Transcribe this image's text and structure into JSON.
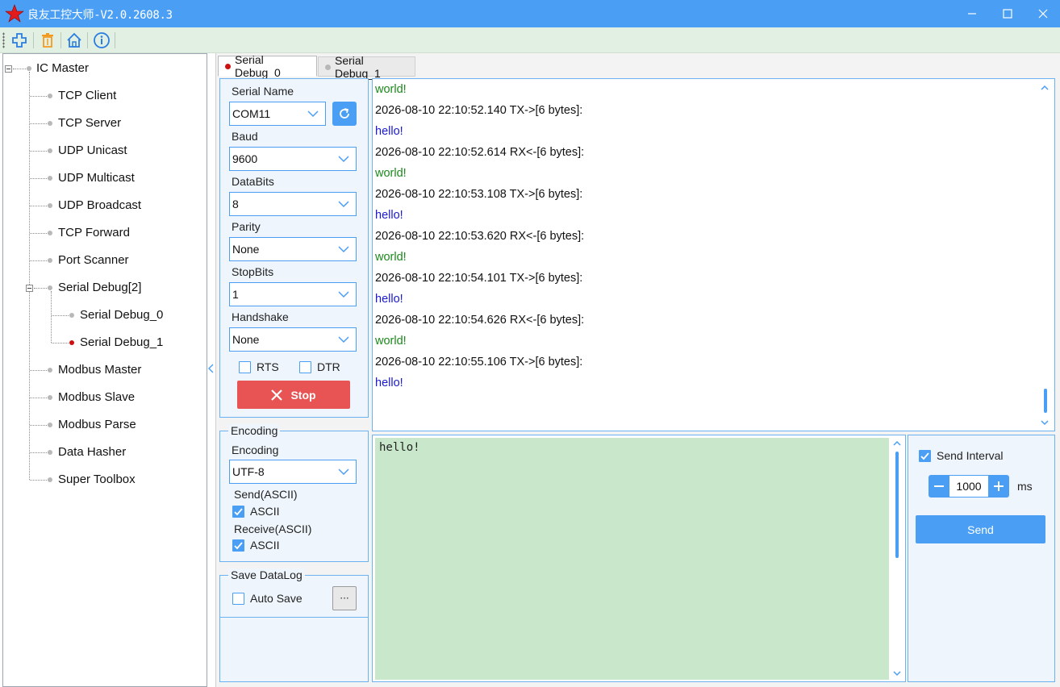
{
  "window": {
    "title": "良友工控大师-V2.0.2608.3",
    "controls": [
      "minimize",
      "maximize",
      "close"
    ]
  },
  "toolbar": {
    "items": [
      {
        "name": "add",
        "icon": "plus-icon"
      },
      {
        "name": "delete",
        "icon": "trash-icon"
      },
      {
        "name": "home",
        "icon": "home-icon"
      },
      {
        "name": "info",
        "icon": "info-icon"
      }
    ]
  },
  "tree": {
    "root": "IC Master",
    "items": [
      "TCP Client",
      "TCP Server",
      "UDP Unicast",
      "UDP Multicast",
      "UDP Broadcast",
      "TCP Forward",
      "Port Scanner",
      "Serial Debug[2]",
      "Serial Debug_0",
      "Serial Debug_1",
      "Modbus Master",
      "Modbus Slave",
      "Modbus Parse",
      "Data Hasher",
      "Super Toolbox"
    ]
  },
  "tabs": [
    {
      "label": "Serial Debug_0",
      "active": true,
      "dot_color": "#cc1111"
    },
    {
      "label": "Serial Debug_1",
      "active": false,
      "dot_color": "#b8b8b8"
    }
  ],
  "serial": {
    "name_label": "Serial Name",
    "name_value": "COM11",
    "baud_label": "Baud",
    "baud_value": "9600",
    "databits_label": "DataBits",
    "databits_value": "8",
    "parity_label": "Parity",
    "parity_value": "None",
    "stopbits_label": "StopBits",
    "stopbits_value": "1",
    "handshake_label": "Handshake",
    "handshake_value": "None",
    "rts_label": "RTS",
    "dtr_label": "DTR",
    "stop_label": "Stop"
  },
  "encoding": {
    "group_title": "Encoding",
    "label": "Encoding",
    "value": "UTF-8",
    "send_label": "Send(ASCII)",
    "send_check": "ASCII",
    "recv_label": "Receive(ASCII)",
    "recv_check": "ASCII"
  },
  "datalog": {
    "group_title": "Save DataLog",
    "auto_save_label": "Auto Save",
    "browse_label": "···"
  },
  "log": [
    {
      "text": "world!",
      "color": "#1a8a1a"
    },
    {
      "text": "2026-08-10 22:10:52.140 TX->[6 bytes]:",
      "color": "#111111"
    },
    {
      "text": "hello!",
      "color": "#1a1acc"
    },
    {
      "text": "2026-08-10 22:10:52.614 RX<-[6 bytes]:",
      "color": "#111111"
    },
    {
      "text": "world!",
      "color": "#1a8a1a"
    },
    {
      "text": "2026-08-10 22:10:53.108 TX->[6 bytes]:",
      "color": "#111111"
    },
    {
      "text": "hello!",
      "color": "#1a1acc"
    },
    {
      "text": "2026-08-10 22:10:53.620 RX<-[6 bytes]:",
      "color": "#111111"
    },
    {
      "text": "world!",
      "color": "#1a8a1a"
    },
    {
      "text": "2026-08-10 22:10:54.101 TX->[6 bytes]:",
      "color": "#111111"
    },
    {
      "text": "hello!",
      "color": "#1a1acc"
    },
    {
      "text": "2026-08-10 22:10:54.626 RX<-[6 bytes]:",
      "color": "#111111"
    },
    {
      "text": "world!",
      "color": "#1a8a1a"
    },
    {
      "text": "2026-08-10 22:10:55.106 TX->[6 bytes]:",
      "color": "#111111"
    },
    {
      "text": "hello!",
      "color": "#1a1acc"
    }
  ],
  "send": {
    "text": "hello!",
    "interval_label": "Send Interval",
    "interval_value": "1000",
    "interval_unit": "ms",
    "button_label": "Send"
  },
  "colors": {
    "accent": "#4a9ff5",
    "stop": "#e85454",
    "send_bg": "#c9e8cb",
    "toolbar_bg": "#e1f0e3"
  }
}
